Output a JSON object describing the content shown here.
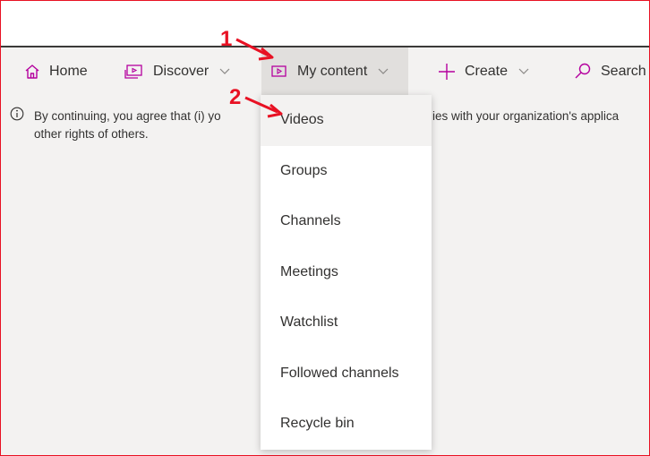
{
  "nav": {
    "home_label": "Home",
    "discover_label": "Discover",
    "mycontent_label": "My content",
    "create_label": "Create",
    "search_label": "Search"
  },
  "info": {
    "line1_part1": "By continuing, you agree that (i) yo",
    "line1_part2": "ies with your organization's applica",
    "line2": "other rights of others."
  },
  "dropdown": {
    "items": [
      {
        "label": "Videos"
      },
      {
        "label": "Groups"
      },
      {
        "label": "Channels"
      },
      {
        "label": "Meetings"
      },
      {
        "label": "Watchlist"
      },
      {
        "label": "Followed channels"
      },
      {
        "label": "Recycle bin"
      }
    ]
  },
  "annotations": {
    "step1": "1",
    "step2": "2"
  },
  "colors": {
    "accent": "#b4009e",
    "annotation": "#e81123",
    "menu_bg": "#f3f2f1",
    "active_bg": "#e1dfdd"
  }
}
